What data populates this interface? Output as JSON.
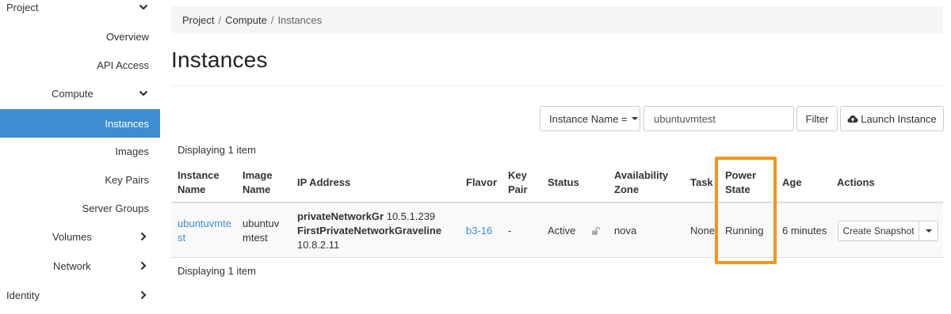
{
  "sidebar": {
    "project": "Project",
    "overview": "Overview",
    "api_access": "API Access",
    "compute": "Compute",
    "instances": "Instances",
    "images": "Images",
    "key_pairs": "Key Pairs",
    "server_groups": "Server Groups",
    "volumes": "Volumes",
    "network": "Network",
    "identity": "Identity"
  },
  "breadcrumb": {
    "items": [
      "Project",
      "Compute",
      "Instances"
    ],
    "separator": "/"
  },
  "page": {
    "title": "Instances"
  },
  "filter": {
    "field": "Instance Name =",
    "value": "ubuntuvmtest",
    "filter_label": "Filter",
    "launch_label": "Launch Instance"
  },
  "table": {
    "displaying_top": "Displaying 1 item",
    "displaying_bottom": "Displaying 1 item",
    "headers": {
      "instance_name_1": "Instance",
      "instance_name_2": "Name",
      "image_name_1": "Image",
      "image_name_2": "Name",
      "ip_address": "IP Address",
      "flavor": "Flavor",
      "key_pair_1": "Key",
      "key_pair_2": "Pair",
      "status": "Status",
      "az_1": "Availability",
      "az_2": "Zone",
      "task": "Task",
      "power_state_1": "Power",
      "power_state_2": "State",
      "age": "Age",
      "actions": "Actions"
    },
    "row": {
      "instance_name_1": "ubuntuvmte",
      "instance_name_2": "st",
      "image_name_1": "ubuntuv",
      "image_name_2": "mtest",
      "ip_net1_name": "privateNetworkGr",
      "ip_net1_addr": "10.5.1.239",
      "ip_net2_name": "FirstPrivateNetworkGraveline",
      "ip_net2_addr": "10.8.2.11",
      "flavor": "b3-16",
      "key_pair": "-",
      "status": "Active",
      "availability_zone": "nova",
      "task": "None",
      "power_state": "Running",
      "age": "6 minutes",
      "action_label": "Create Snapshot"
    }
  },
  "colors": {
    "accent": "#3c8dd1",
    "highlight": "#f7931e"
  }
}
